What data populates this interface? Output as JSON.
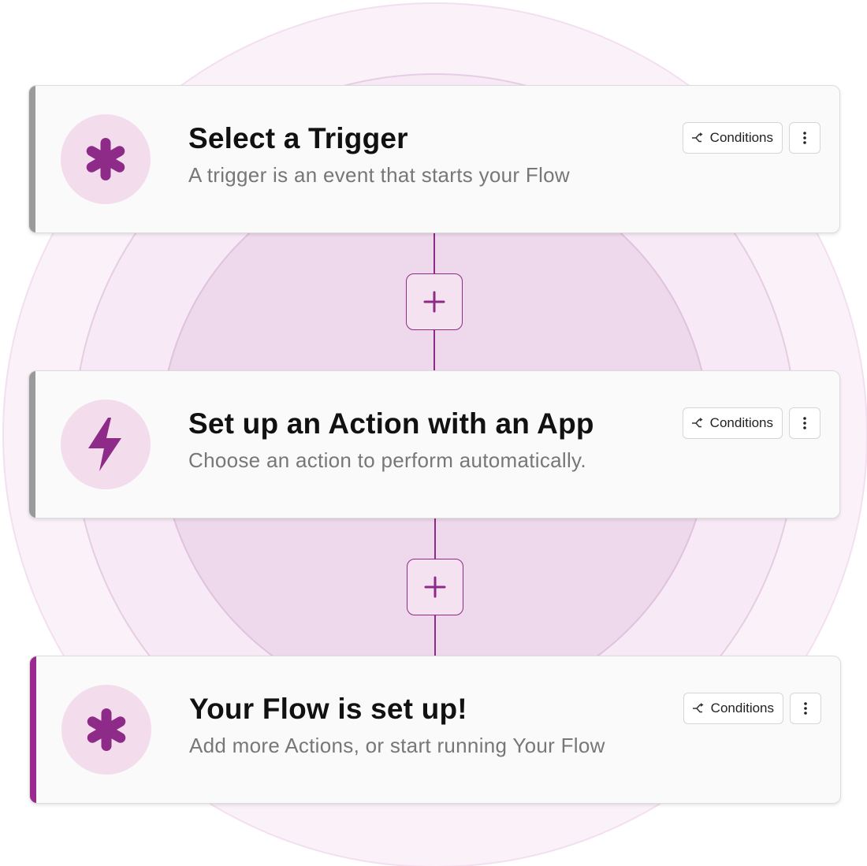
{
  "colors": {
    "accent": "#8e2a87",
    "icon_bg": "#f3dcec",
    "card_bg": "#fafafa",
    "inactive_stripe": "#9a9a9a",
    "active_stripe": "#9b2a8e"
  },
  "steps": [
    {
      "title": "Select a Trigger",
      "subtitle": "A trigger is an event that starts your Flow",
      "icon": "asterisk-icon",
      "conditions_label": "Conditions",
      "active": false
    },
    {
      "title": "Set up an Action with an App",
      "subtitle": "Choose an action to perform automatically.",
      "icon": "lightning-bolt-icon",
      "conditions_label": "Conditions",
      "active": false
    },
    {
      "title": "Your Flow is set up!",
      "subtitle": "Add more Actions, or start running Your Flow",
      "icon": "asterisk-icon",
      "conditions_label": "Conditions",
      "active": true
    }
  ],
  "connectors": [
    {
      "icon": "plus-icon"
    },
    {
      "icon": "plus-icon"
    }
  ]
}
